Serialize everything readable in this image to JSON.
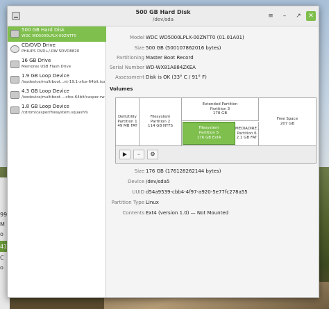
{
  "window": {
    "title": "500 GB Hard Disk",
    "subtitle": "/dev/sda",
    "menu_icon": "hamburger-icon",
    "minimize_icon": "minimize-icon",
    "maximize_icon": "maximize-icon",
    "close_icon": "close-icon"
  },
  "sidebar": {
    "devices": [
      {
        "name": "500 GB Hard Disk",
        "desc": "WDC WD5000LPLX-00ZNTT0",
        "icon": "hard-disk-icon",
        "selected": true
      },
      {
        "name": "CD/DVD Drive",
        "desc": "PHILIPS DVD+/-RW SDVD8820",
        "icon": "optical-disc-icon"
      },
      {
        "name": "16 GB Drive",
        "desc": "Memorex USB Flash Drive",
        "icon": "usb-drive-icon"
      },
      {
        "name": "1.9 GB Loop Device",
        "desc": "/isodevice/multiboot...nt-19.1-xfce-64bit.iso",
        "icon": "loop-device-icon"
      },
      {
        "name": "4.3 GB Loop Device",
        "desc": "/isodevice/multiboot...-xfce-64bit/casper-rw",
        "icon": "loop-device-icon"
      },
      {
        "name": "1.8 GB Loop Device",
        "desc": "/cdrom/casper/filesystem.squashfs",
        "icon": "loop-device-icon"
      }
    ]
  },
  "disk_info": {
    "model_label": "Model",
    "model": "WDC WD5000LPLX-00ZNTT0 (01.01A01)",
    "size_label": "Size",
    "size": "500 GB (500107862016 bytes)",
    "partitioning_label": "Partitioning",
    "partitioning": "Master Boot Record",
    "serial_label": "Serial Number",
    "serial": "WD-WX81A884ZKEA",
    "assessment_label": "Assessment",
    "assessment": "Disk is OK (33° C / 91° F)"
  },
  "volumes": {
    "title": "Volumes",
    "partitions": {
      "p1": {
        "line1": "DellUtility",
        "line2": "Partition 1",
        "line3": "49 MB FAT"
      },
      "p2": {
        "line1": "Filesystem",
        "line2": "Partition 2",
        "line3": "114 GB NTFS"
      },
      "ext": {
        "line1": "Extended Partition",
        "line2": "Partition 3",
        "line3": "178 GB"
      },
      "p5": {
        "line1": "Filesystem",
        "line2": "Partition 5",
        "line3": "176 GB Ext4"
      },
      "p6": {
        "line1": "MEDIADIRE...",
        "line2": "Partition 6",
        "line3": "2.1 GB FAT"
      },
      "free": {
        "line1": "Free Space",
        "line2": "207 GB"
      }
    },
    "toolbar": {
      "play_icon": "play-icon",
      "minus_icon": "minus-icon",
      "gears_icon": "gears-icon"
    }
  },
  "partition_info": {
    "size_label": "Size",
    "size": "176 GB (176128262144 bytes)",
    "device_label": "Device",
    "device": "/dev/sda5",
    "uuid_label": "UUID",
    "uuid": "d54a9539-cbb4-4f97-a920-5e77fc278a55",
    "type_label": "Partition Type",
    "type": "Linux",
    "contents_label": "Contents",
    "contents": "Ext4 (version 1.0) — Not Mounted"
  },
  "desktop_peek": {
    "a": "99",
    "b": "M",
    "c": "o",
    "d": "41",
    "e": "C",
    "f": "o"
  }
}
